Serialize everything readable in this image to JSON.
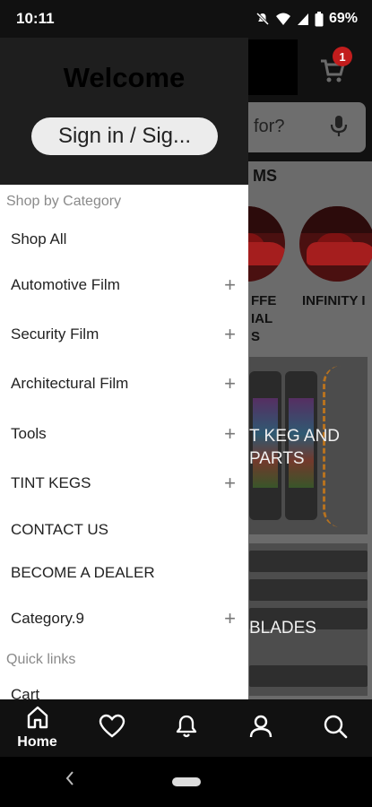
{
  "status_bar": {
    "time": "10:11",
    "battery": "69%",
    "icons": [
      "mute-icon",
      "wifi-icon",
      "signal-icon",
      "battery-icon"
    ]
  },
  "background_app": {
    "cart_badge": "1",
    "search_placeholder": "for?",
    "section_title": "MS",
    "collection_labels": [
      "FFE\nIAL\nS",
      "INFINITY I"
    ],
    "banner1_text": "T KEG AND\n PARTS",
    "banner2_text": "BLADES",
    "colors": {
      "badge": "#c21d1d",
      "header": "#111111"
    }
  },
  "drawer": {
    "welcome": "Welcome",
    "signin_label": "Sign in / Sig...",
    "section_category": "Shop by Category",
    "items": [
      {
        "label": "Shop All",
        "expandable": false
      },
      {
        "label": "Automotive Film",
        "expandable": true
      },
      {
        "label": "Security Film",
        "expandable": true
      },
      {
        "label": "Architectural Film",
        "expandable": true
      },
      {
        "label": "Tools",
        "expandable": true
      },
      {
        "label": "TINT KEGS",
        "expandable": true
      },
      {
        "label": "CONTACT US",
        "expandable": false
      },
      {
        "label": "BECOME A DEALER",
        "expandable": false
      },
      {
        "label": "Category.9",
        "expandable": true
      }
    ],
    "expand_symbol": "+",
    "section_quick": "Quick links",
    "quick_links": [
      "Cart"
    ]
  },
  "bottom_nav": {
    "home_label": "Home",
    "items": [
      "home-icon",
      "heart-icon",
      "bell-icon",
      "user-icon",
      "search-icon"
    ]
  }
}
